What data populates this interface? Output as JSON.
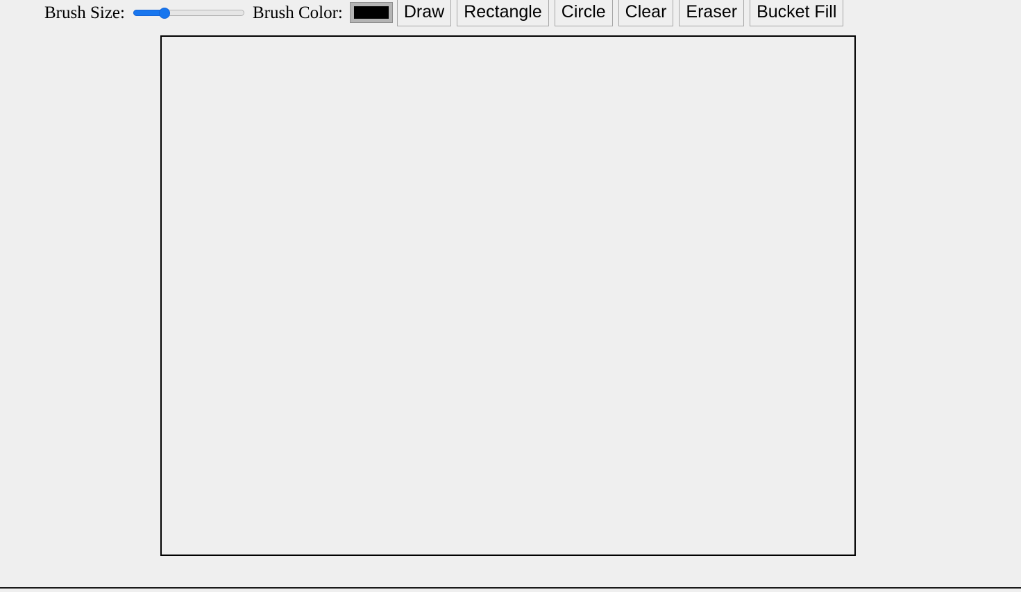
{
  "toolbar": {
    "brush_size_label": "Brush Size:",
    "brush_color_label": "Brush Color:",
    "brush_size": {
      "value": 26,
      "min": 1,
      "max": 100,
      "fill_percent": 26
    },
    "brush_color": {
      "value": "#000000",
      "border_color": "#8f8f8f"
    },
    "buttons": [
      {
        "name": "draw",
        "label": "Draw"
      },
      {
        "name": "rectangle",
        "label": "Rectangle"
      },
      {
        "name": "circle",
        "label": "Circle"
      },
      {
        "name": "clear",
        "label": "Clear"
      },
      {
        "name": "eraser",
        "label": "Eraser"
      },
      {
        "name": "bucket-fill",
        "label": "Bucket Fill"
      }
    ]
  },
  "canvas": {
    "content": "",
    "background": "#efefef",
    "border_color": "#000000"
  },
  "theme": {
    "page_background": "#efefef",
    "accent": "#1876ee",
    "text": "#000000"
  }
}
